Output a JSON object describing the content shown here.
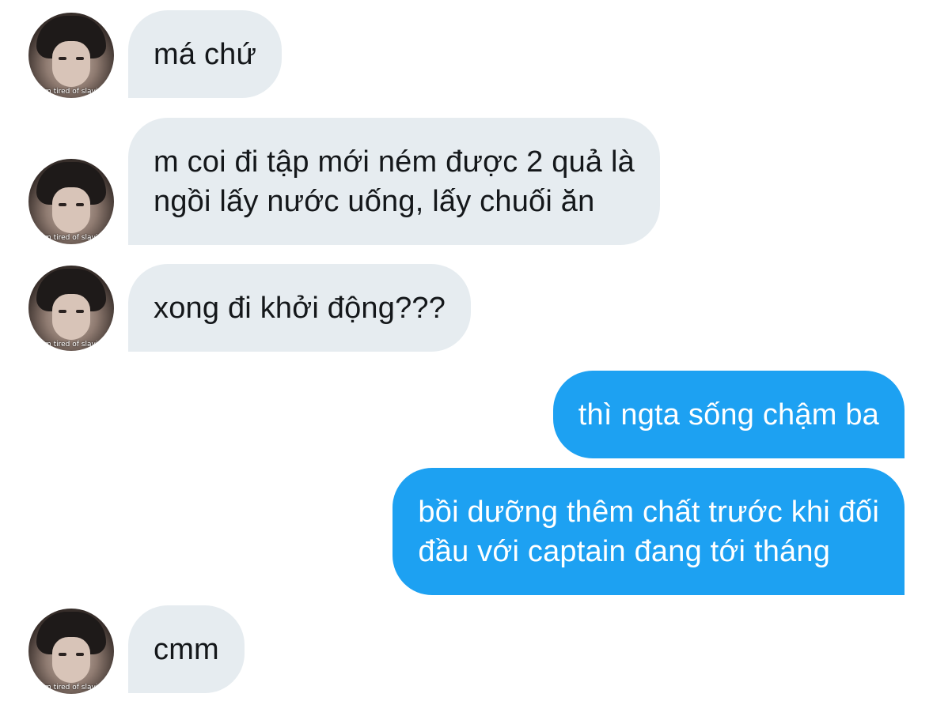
{
  "conversation": {
    "avatar_caption": "i'm tired of slavin",
    "messages": [
      {
        "sender": "other",
        "text": "má chứ"
      },
      {
        "sender": "other",
        "text": "m coi đi tập mới ném được 2 quả là\nngồi lấy nước uống, lấy chuối ăn"
      },
      {
        "sender": "other",
        "text": "xong đi khởi động???"
      },
      {
        "sender": "me",
        "text": "thì ngta sống chậm ba"
      },
      {
        "sender": "me",
        "text": "bồi dưỡng thêm chất trước khi đối\nđầu với captain đang tới tháng"
      },
      {
        "sender": "other",
        "text": "cmm"
      }
    ]
  },
  "colors": {
    "incoming_bubble": "#e6ecf0",
    "outgoing_bubble": "#1da1f2",
    "incoming_text": "#14171a",
    "outgoing_text": "#ffffff"
  }
}
